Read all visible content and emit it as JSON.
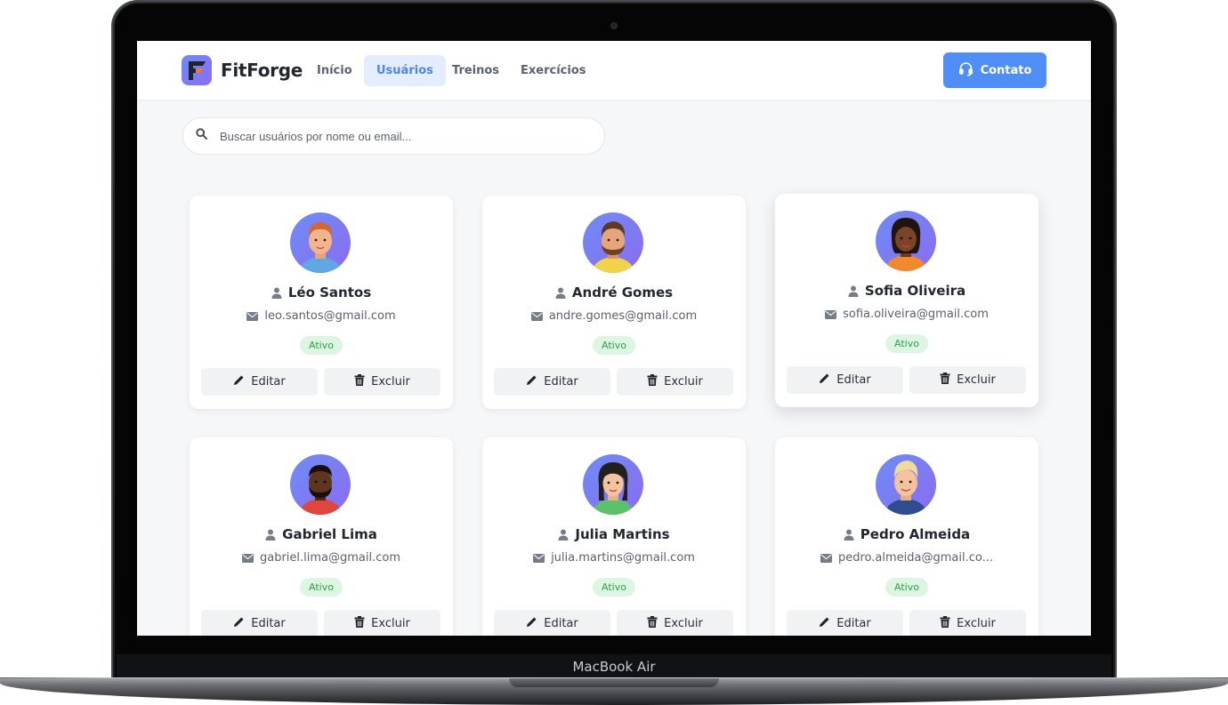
{
  "device": {
    "label": "MacBook Air"
  },
  "navbar": {
    "brand": "FitForge",
    "links": [
      {
        "label": "Início",
        "active": false
      },
      {
        "label": "Usuários",
        "active": true
      },
      {
        "label": "Treinos",
        "active": false
      },
      {
        "label": "Exercícios",
        "active": false
      }
    ],
    "contact_label": "Contato"
  },
  "search": {
    "placeholder": "Buscar usuários por nome ou email..."
  },
  "actions": {
    "edit_label": "Editar",
    "delete_label": "Excluir"
  },
  "users": [
    {
      "name": "Léo Santos",
      "email": "leo.santos@gmail.com",
      "status": "Ativo"
    },
    {
      "name": "André Gomes",
      "email": "andre.gomes@gmail.com",
      "status": "Ativo"
    },
    {
      "name": "Sofia Oliveira",
      "email": "sofia.oliveira@gmail.com",
      "status": "Ativo"
    },
    {
      "name": "Gabriel Lima",
      "email": "gabriel.lima@gmail.com",
      "status": "Ativo"
    },
    {
      "name": "Julia Martins",
      "email": "julia.martins@gmail.com",
      "status": "Ativo"
    },
    {
      "name": "Pedro Almeida",
      "email": "pedro.almeida@gmail.co...",
      "status": "Ativo"
    }
  ],
  "colors": {
    "accent": "#4f8ef6",
    "active_nav_bg": "#e4edfd",
    "status_bg": "#dcf6e2",
    "status_text": "#2e9e4e",
    "avatar_gradient_start": "#6e8cf5",
    "avatar_gradient_end": "#8b6cf0"
  }
}
